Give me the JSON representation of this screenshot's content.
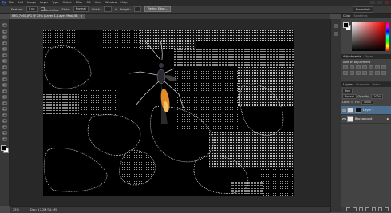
{
  "app": {
    "logo": "Ps",
    "menus": [
      "File",
      "Edit",
      "Image",
      "Layer",
      "Type",
      "Select",
      "Filter",
      "3D",
      "View",
      "Window",
      "Help"
    ]
  },
  "options": {
    "feather_label": "Feather:",
    "feather_value": "0 px",
    "antialias_label": "Anti-alias",
    "style_label": "Style:",
    "style_value": "Normal",
    "width_label": "Width:",
    "height_label": "Height:",
    "refine_label": "Refine Edge...",
    "workspace_label": "Essentials"
  },
  "document": {
    "tab_title": "IMG_7460.JPG @ 25% (Layer 1, Layer Mask/8)",
    "zoom": "25%",
    "doc_size": "Doc: 17.2M/34.4M"
  },
  "tools": [
    "move-icon",
    "marquee-icon",
    "lasso-icon",
    "quick-select-icon",
    "crop-icon",
    "eyedropper-icon",
    "healing-icon",
    "brush-icon",
    "clone-stamp-icon",
    "history-brush-icon",
    "eraser-icon",
    "gradient-icon",
    "blur-icon",
    "dodge-icon",
    "pen-icon",
    "type-icon",
    "path-select-icon",
    "shape-icon",
    "hand-icon",
    "zoom-icon"
  ],
  "panels": {
    "color_tabs": [
      "Color",
      "Swatches"
    ],
    "adjust_tabs": [
      "Adjustments",
      "Styles"
    ],
    "adjust_title": "Add an adjustment",
    "layers_tabs": [
      "Layers",
      "Channels",
      "Paths"
    ],
    "kind_label": "Kind",
    "blend_mode": "Normal",
    "opacity_label": "Opacity:",
    "opacity_value": "100%",
    "lock_label": "Lock:",
    "fill_label": "Fill:",
    "fill_value": "100%",
    "layers": [
      {
        "name": "Layer 1",
        "selected": true
      },
      {
        "name": "Background",
        "selected": false
      }
    ]
  },
  "colors": {
    "accent": "#4d6f8f",
    "foreground": "#000000",
    "background": "#ffffff"
  }
}
